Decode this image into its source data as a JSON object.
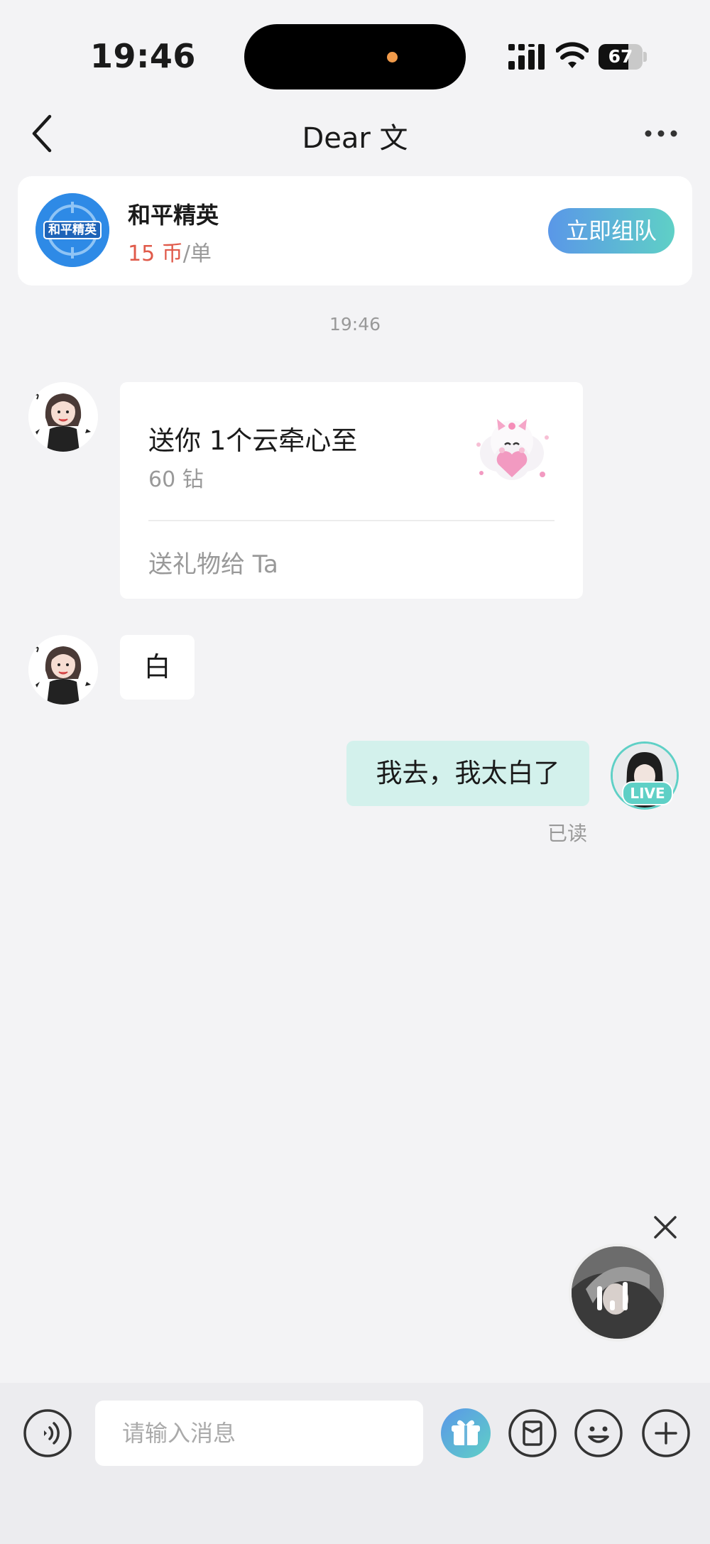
{
  "status_bar": {
    "time": "19:46",
    "battery": "67",
    "battery_level": 0.67
  },
  "header": {
    "title": "Dear 文"
  },
  "game_card": {
    "icon_text": "和平精英",
    "name": "和平精英",
    "price": "15 币",
    "unit": "/单",
    "action": "立即组队"
  },
  "chat": {
    "timestamp": "19:46",
    "gift_message": {
      "title": "送你 1个云牵心至",
      "cost": "60 钻",
      "action": "送礼物给 Ta"
    },
    "incoming_text": "白",
    "outgoing_text": "我去，我太白了",
    "read_status": "已读",
    "live_badge": "LIVE"
  },
  "composer": {
    "placeholder": "请输入消息"
  },
  "colors": {
    "accent_start": "#5a97e8",
    "accent_end": "#5fd0c6",
    "price_red": "#e05a4a",
    "outgoing_bubble": "#d3f1ec",
    "background": "#f3f3f5"
  },
  "icons": [
    "back-icon",
    "more-icon",
    "close-icon",
    "voice-icon",
    "gift-icon",
    "red-packet-icon",
    "emoji-icon",
    "plus-icon"
  ]
}
